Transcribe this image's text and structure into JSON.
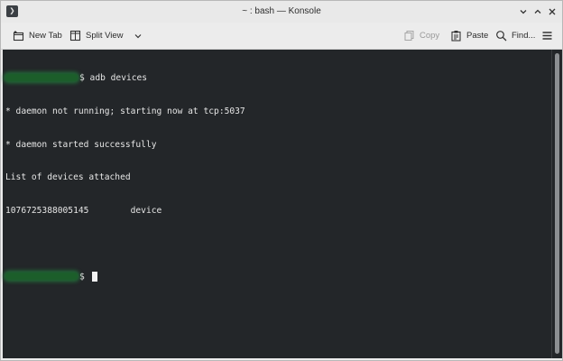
{
  "window": {
    "title": "~ : bash — Konsole",
    "app_icon_glyph": "❯"
  },
  "toolbar": {
    "new_tab_label": "New Tab",
    "split_view_label": "Split View",
    "copy_label": "Copy",
    "paste_label": "Paste",
    "find_label": "Find..."
  },
  "terminal": {
    "lines": [
      {
        "prompt_user_hidden": true,
        "text": "$ adb devices"
      },
      {
        "text": "* daemon not running; starting now at tcp:5037"
      },
      {
        "text": "* daemon started successfully"
      },
      {
        "text": "List of devices attached"
      },
      {
        "text": "1076725388005145        device"
      }
    ],
    "prompt_text": "$ "
  },
  "colors": {
    "terminal_bg": "#232629",
    "terminal_fg": "#e6e6e6",
    "chrome_bg": "#ececec"
  }
}
